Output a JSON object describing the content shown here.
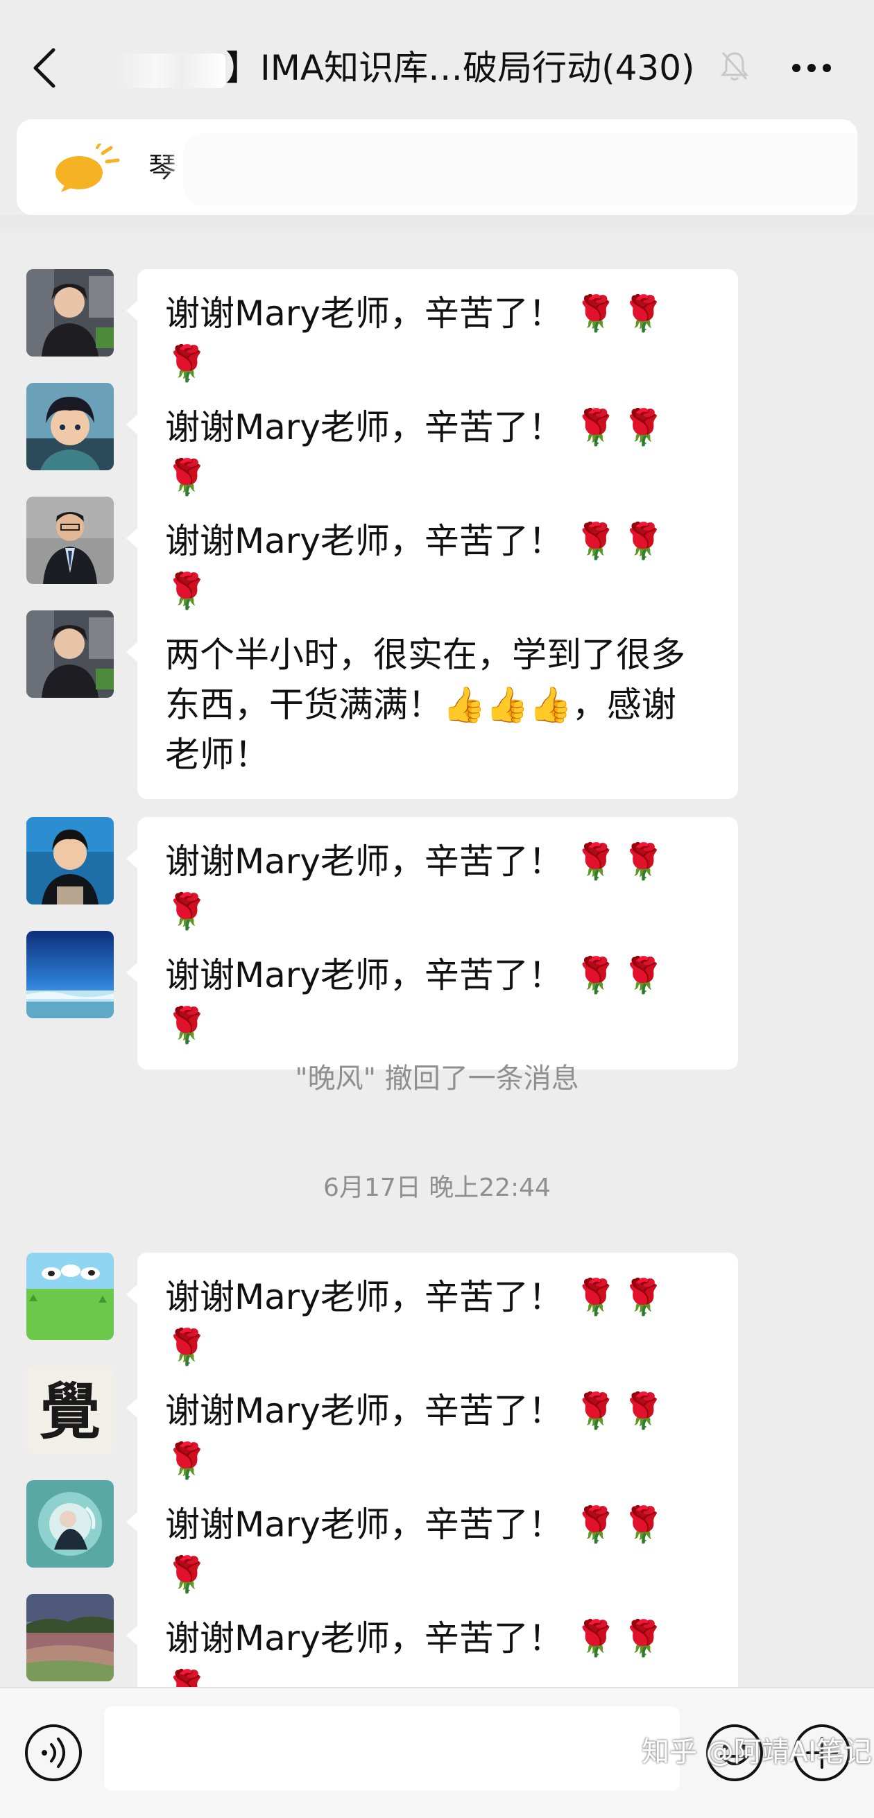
{
  "header": {
    "title_prefix": "】IMA知识库…破局行动",
    "member_count": "(430)",
    "back_icon": "chevron-left-icon",
    "mute_icon": "bell-muted-icon",
    "more_icon": "ellipsis-icon"
  },
  "notice": {
    "icon": "announcement-bubble-icon",
    "text": "琴"
  },
  "messages": [
    {
      "avatar": "woman-photo",
      "text": "谢谢Mary老师，辛苦了！",
      "emoji": "🌹🌹🌹"
    },
    {
      "avatar": "anime-boy",
      "text": "谢谢Mary老师，辛苦了！",
      "emoji": "🌹🌹🌹"
    },
    {
      "avatar": "man-suit",
      "text": "谢谢Mary老师，辛苦了！",
      "emoji": "🌹🌹🌹"
    },
    {
      "avatar": "woman-photo",
      "lines": [
        "两个半小时，很实在，学到了很多",
        "东西，干货满满！👍👍👍，感谢",
        "老师！"
      ]
    },
    {
      "avatar": "boy-laptop",
      "text": "谢谢Mary老师，辛苦了！",
      "emoji": "🌹🌹🌹"
    },
    {
      "avatar": "blue-sky",
      "text": "谢谢Mary老师，辛苦了！",
      "emoji": "🌹🌹🌹"
    },
    {
      "avatar": "cows-meadow",
      "text": "谢谢Mary老师，辛苦了！",
      "emoji": "🌹🌹🌹"
    },
    {
      "avatar": "calligraphy",
      "avatar_text": "覺",
      "text": "谢谢Mary老师，辛苦了！",
      "emoji": "🌹🌹🌹"
    },
    {
      "avatar": "anime-fantasy",
      "text": "谢谢Mary老师，辛苦了！",
      "emoji": "🌹🌹🌹"
    },
    {
      "avatar": "flower-field",
      "text": "谢谢Mary老师，辛苦了！",
      "emoji": "🌹🌹🌹"
    }
  ],
  "system": {
    "recall_notice": "\"晚风\" 撤回了一条消息",
    "timestamp": "6月17日 晚上22:44"
  },
  "input_bar": {
    "voice_icon": "voice-icon",
    "emoji_icon": "emoji-icon",
    "plus_icon": "plus-icon",
    "input_value": ""
  },
  "watermark": "知乎 @阿靖AI笔记"
}
